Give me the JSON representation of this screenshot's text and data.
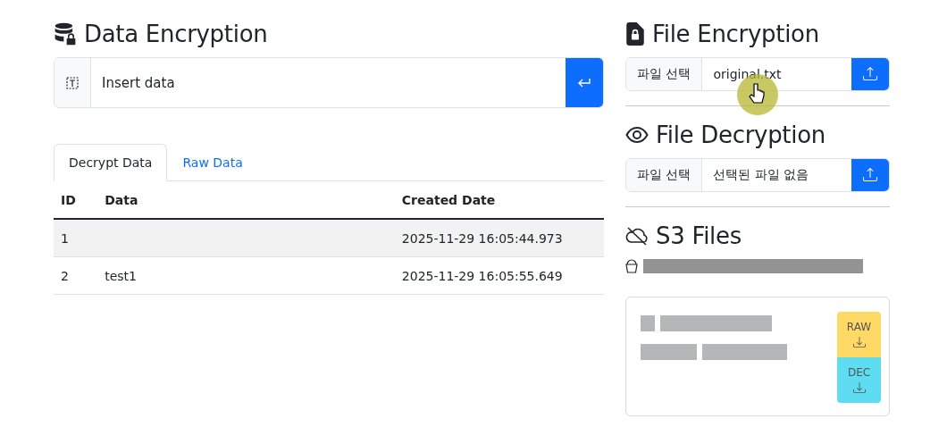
{
  "data_encryption": {
    "title": "Data Encryption",
    "input": {
      "placeholder": "Insert data"
    }
  },
  "tabs": [
    {
      "label": "Decrypt Data",
      "selected": true
    },
    {
      "label": "Raw Data",
      "selected": false
    }
  ],
  "table": {
    "columns": [
      "ID",
      "Data",
      "Created Date"
    ],
    "rows": [
      {
        "cells": [
          "1",
          "",
          "2025-11-29 16:05:44.973"
        ],
        "highlighted": true
      },
      {
        "cells": [
          "2",
          "test1",
          "2025-11-29 16:05:55.649"
        ],
        "highlighted": false
      }
    ]
  },
  "file_encryption": {
    "title": "File Encryption",
    "choose_label": "파일 선택",
    "file_name": "original.txt"
  },
  "file_decryption": {
    "title": "File Decryption",
    "choose_label": "파일 선택",
    "file_name": "선택된 파일 없음"
  },
  "s3_files": {
    "title": "S3 Files",
    "file_card": {
      "buttons": [
        {
          "label": "RAW",
          "kind": "raw"
        },
        {
          "label": "DEC",
          "kind": "dec"
        }
      ]
    }
  }
}
